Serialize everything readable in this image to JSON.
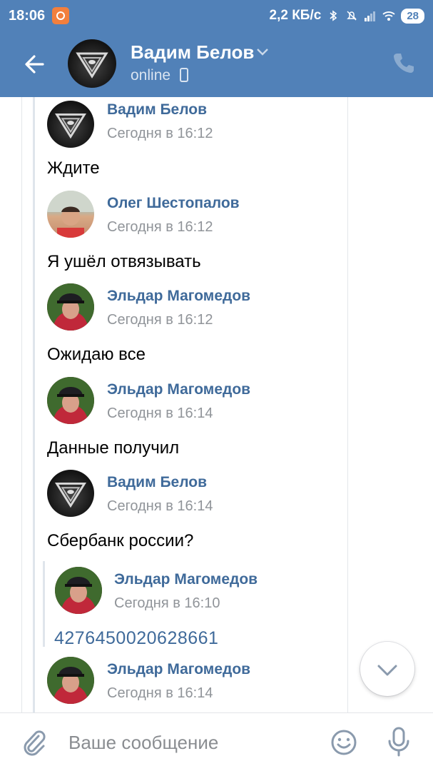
{
  "status_bar": {
    "time": "18:06",
    "network_speed": "2,2 КБ/с",
    "battery": "28"
  },
  "header": {
    "name": "Вадим Белов",
    "status": "online"
  },
  "messages": [
    {
      "author": "Вадим Белов",
      "time": "Сегодня в 16:12",
      "text": "Ждите"
    },
    {
      "author": "Олег Шестопалов",
      "time": "Сегодня в 16:12",
      "text": "Я ушёл отвязывать"
    },
    {
      "author": "Эльдар Магомедов",
      "time": "Сегодня в 16:12",
      "text": "Ожидаю все"
    },
    {
      "author": "Эльдар Магомедов",
      "time": "Сегодня в 16:14",
      "text": "Данные получил"
    },
    {
      "author": "Вадим Белов",
      "time": "Сегодня в 16:14",
      "text": "Сбербанк россии?"
    }
  ],
  "quoted": {
    "author": "Эльдар Магомедов",
    "time": "Сегодня в 16:10",
    "text": "4276450020628661"
  },
  "last_message": {
    "author": "Эльдар Магомедов",
    "time": "Сегодня в 16:14"
  },
  "input": {
    "placeholder": "Ваше сообщение"
  },
  "colors": {
    "header_bg": "#5181b8",
    "author_link": "#3f6a9a",
    "time_gray": "#909499"
  },
  "icons": [
    "back-arrow-icon",
    "chevron-down-icon",
    "phone-icon",
    "mobile-icon",
    "paperclip-icon",
    "smile-icon",
    "microphone-icon",
    "chevron-down-icon"
  ]
}
